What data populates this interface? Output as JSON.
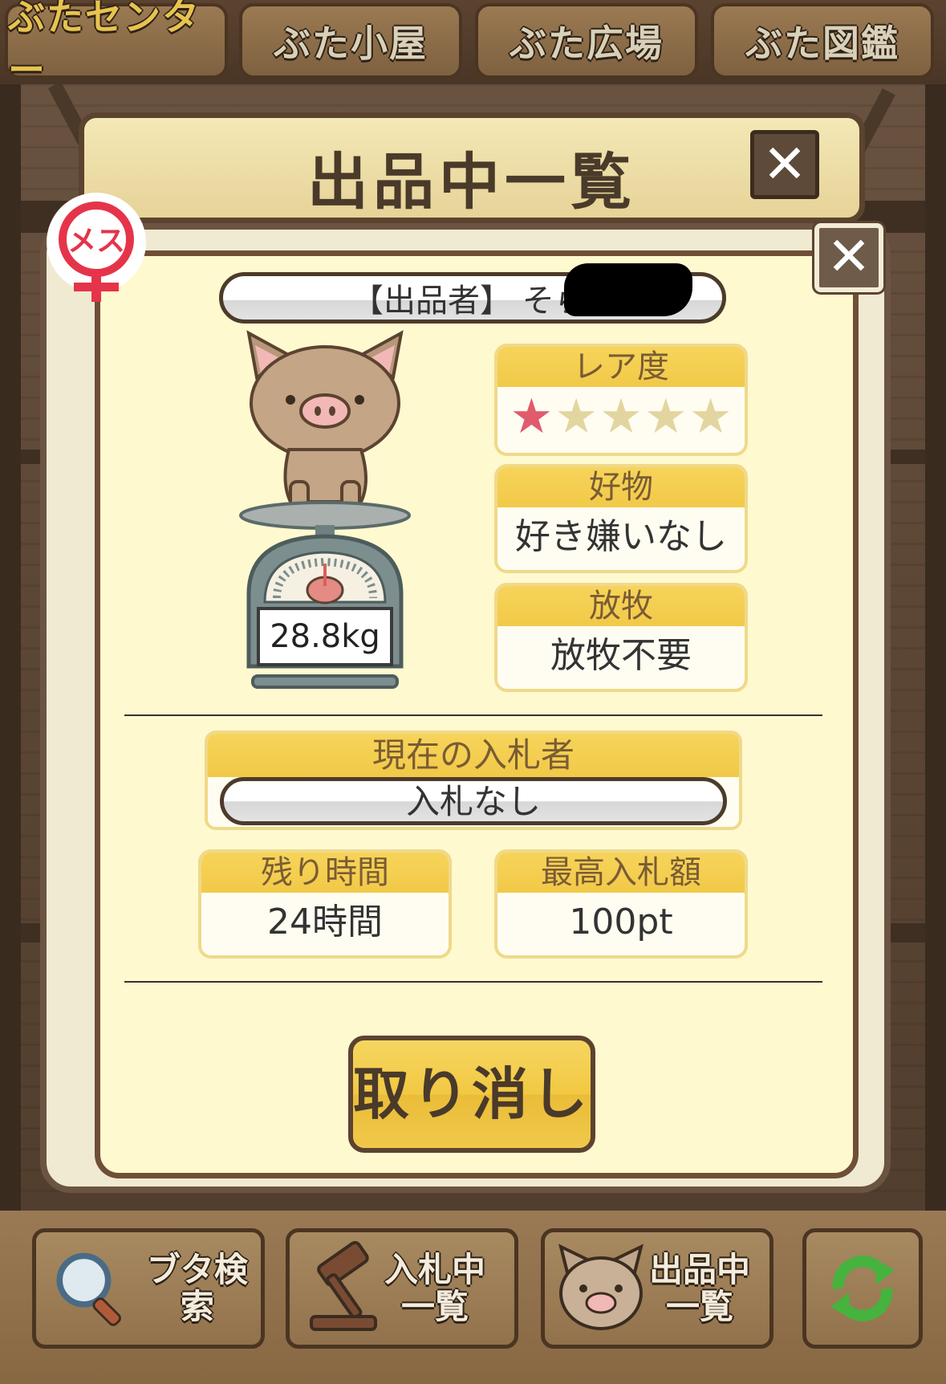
{
  "top_tabs": [
    {
      "label": "ぶたセンター",
      "active": true
    },
    {
      "label": "ぶた小屋",
      "active": false
    },
    {
      "label": "ぶた広場",
      "active": false
    },
    {
      "label": "ぶた図鑑",
      "active": false
    }
  ],
  "header": {
    "title": "出品中一覧",
    "close": "✕"
  },
  "dialog": {
    "close": "✕"
  },
  "gender_badge": {
    "label": "メス"
  },
  "seller": {
    "text": "【出品者】 そら"
  },
  "pig": {
    "weight": "28.8kg"
  },
  "rarity": {
    "label": "レア度",
    "stars_filled": 1,
    "stars_total": 5
  },
  "favorite": {
    "label": "好物",
    "value": "好き嫌いなし"
  },
  "grazing": {
    "label": "放牧",
    "value": "放牧不要"
  },
  "bidder": {
    "label": "現在の入札者",
    "value": "入札なし"
  },
  "remaining": {
    "label": "残り時間",
    "value": "24時間"
  },
  "max_bid": {
    "label": "最高入札額",
    "value": "100pt"
  },
  "cancel_button": {
    "label": "取り消し"
  },
  "bottom_bar": {
    "search": "ブタ検索",
    "bidding_line1": "入札中",
    "bidding_line2": "一覧",
    "listing_line1": "出品中",
    "listing_line2": "一覧"
  },
  "colors": {
    "accent": "#f2c948",
    "star_on": "#e05b6b",
    "star_off": "#e3d59f",
    "wood": "#5b4330"
  }
}
